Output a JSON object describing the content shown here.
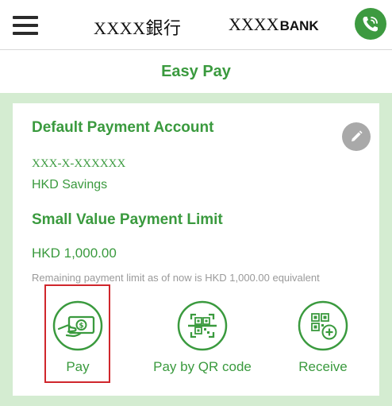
{
  "header": {
    "bank_name_cn": "XXXX銀行",
    "bank_name_en_prefix": "XXXX",
    "bank_name_en_suffix": "BANK",
    "menu_icon": "hamburger-icon",
    "call_icon": "phone-call-icon"
  },
  "page": {
    "title": "Easy Pay"
  },
  "account": {
    "section_title": "Default Payment Account",
    "number": "XXX-X-XXXXXX",
    "type": "HKD Savings",
    "edit_icon": "pencil-icon"
  },
  "limit": {
    "section_title": "Small Value Payment Limit",
    "amount": "HKD 1,000.00",
    "remaining_text": "Remaining payment limit as of now is HKD 1,000.00 equivalent"
  },
  "actions": [
    {
      "label": "Pay",
      "icon": "cash-hand-icon",
      "highlighted": true
    },
    {
      "label": "Pay by QR code",
      "icon": "qr-scan-icon",
      "highlighted": false
    },
    {
      "label": "Receive",
      "icon": "qr-add-icon",
      "highlighted": false
    }
  ],
  "colors": {
    "brand_green": "#3a9a3e",
    "background_green": "#d4ecd1",
    "highlight_red": "#d0262c",
    "edit_grey": "#a9a9a9"
  }
}
